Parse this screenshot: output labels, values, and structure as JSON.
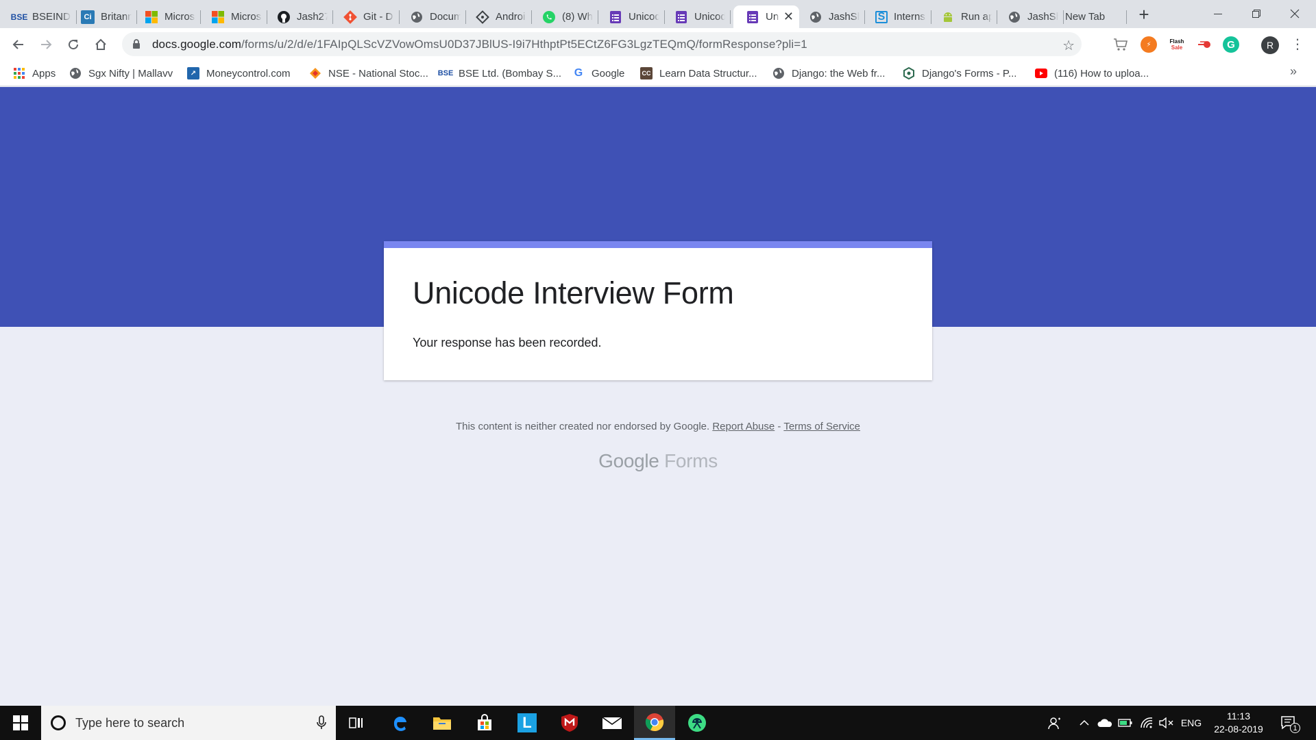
{
  "tabs": [
    {
      "label": "BSEIND",
      "icon": "bse-icon",
      "active": false
    },
    {
      "label": "Britann",
      "icon": "ci-icon",
      "active": false
    },
    {
      "label": "Micros",
      "icon": "microsoft-icon",
      "active": false
    },
    {
      "label": "Micros",
      "icon": "microsoft-icon",
      "active": false
    },
    {
      "label": "Jash27",
      "icon": "github-icon",
      "active": false
    },
    {
      "label": "Git - D",
      "icon": "git-icon",
      "active": false
    },
    {
      "label": "Docum",
      "icon": "globe-icon",
      "active": false
    },
    {
      "label": "Androi",
      "icon": "android-studio-icon",
      "active": false
    },
    {
      "label": "(8) Wh",
      "icon": "whatsapp-icon",
      "active": false
    },
    {
      "label": "Unicod",
      "icon": "google-forms-icon",
      "active": false
    },
    {
      "label": "Unicod",
      "icon": "google-forms-icon",
      "active": false
    },
    {
      "label": "Uni",
      "icon": "google-forms-icon",
      "active": true
    },
    {
      "label": "JashSh",
      "icon": "globe-icon",
      "active": false
    },
    {
      "label": "Interns",
      "icon": "internshala-icon",
      "active": false
    },
    {
      "label": "Run ap",
      "icon": "android-icon",
      "active": false
    },
    {
      "label": "JashSh",
      "icon": "globe-icon",
      "active": false
    },
    {
      "label": "New Tab",
      "icon": "",
      "active": false
    }
  ],
  "toolbar": {
    "url_domain": "docs.google.com",
    "url_path": "/forms/u/2/d/e/1FAIpQLScVZVowOmsU0D37JBlUS-I9i7HthptPt5ECtZ6FG3LgzTEQmQ/formResponse?pli=1",
    "avatar_letter": "R",
    "flash_sale_line1": "Flash",
    "flash_sale_line2": "Sale"
  },
  "bookmarks": [
    {
      "label": "Apps",
      "icon": "apps-grid-icon"
    },
    {
      "label": "Sgx Nifty | Mallavv",
      "icon": "globe-icon"
    },
    {
      "label": "Moneycontrol.com",
      "icon": "moneycontrol-icon"
    },
    {
      "label": "NSE - National Stoc...",
      "icon": "nse-icon"
    },
    {
      "label": "BSE Ltd. (Bombay S...",
      "icon": "bse-icon"
    },
    {
      "label": "Google",
      "icon": "google-icon"
    },
    {
      "label": "Learn Data Structur...",
      "icon": "codechef-icon"
    },
    {
      "label": "Django: the Web fr...",
      "icon": "globe-icon"
    },
    {
      "label": "Django's Forms - P...",
      "icon": "django-icon"
    },
    {
      "label": "(116) How to uploa...",
      "icon": "youtube-icon"
    }
  ],
  "form": {
    "title": "Unicode Interview Form",
    "message": "Your response has been recorded."
  },
  "footer": {
    "disclaimer": "This content is neither created nor endorsed by Google.",
    "report_abuse": "Report Abuse",
    "dash": "-",
    "terms": "Terms of Service",
    "logo_brand": "Google",
    "logo_product": "Forms"
  },
  "taskbar": {
    "search_placeholder": "Type here to search",
    "language": "ENG",
    "time": "11:13",
    "date": "22-08-2019",
    "notification_count": "1"
  },
  "colors": {
    "banner": "#3f51b5",
    "card_accent": "#7986f0",
    "page_bg": "#ebedf6"
  }
}
